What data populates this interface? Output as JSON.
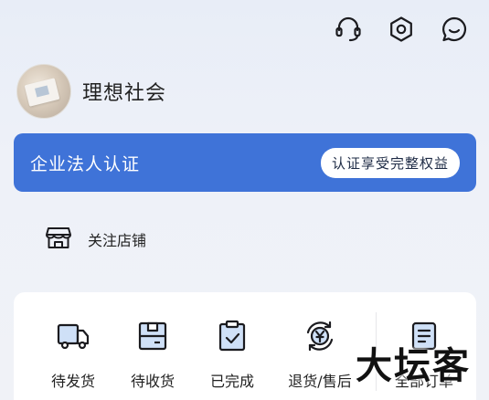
{
  "header": {
    "icons": [
      "customer-service-icon",
      "settings-icon",
      "message-icon"
    ]
  },
  "profile": {
    "shop_name": "理想社会"
  },
  "certification": {
    "title": "企业法人认证",
    "button_label": "认证享受完整权益",
    "color": "#3f73d8"
  },
  "follow": {
    "label": "关注店铺",
    "icon": "store-icon"
  },
  "orders": {
    "items": [
      {
        "label": "待发货",
        "icon": "truck-icon"
      },
      {
        "label": "待收货",
        "icon": "package-icon"
      },
      {
        "label": "已完成",
        "icon": "clipboard-check-icon"
      },
      {
        "label": "退货/售后",
        "icon": "refund-icon"
      },
      {
        "label": "全部订单",
        "icon": "order-list-icon"
      }
    ]
  },
  "watermark": {
    "text": "大坛客"
  }
}
